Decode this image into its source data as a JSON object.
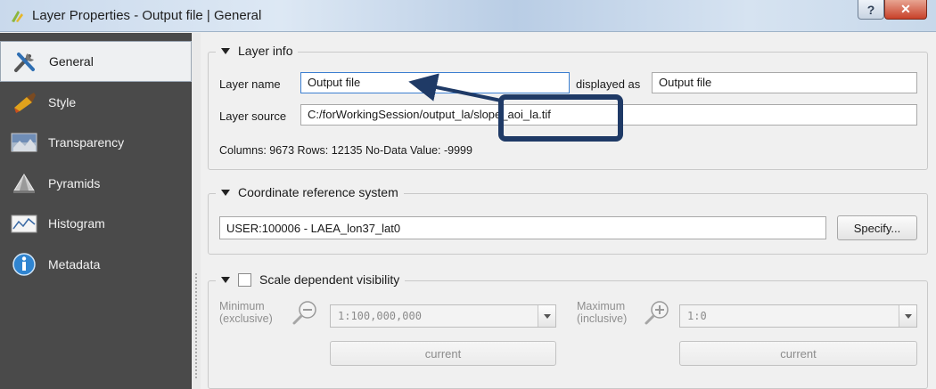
{
  "window": {
    "title": "Layer Properties - Output file | General",
    "help_label": "?",
    "close_label": "✕"
  },
  "sidebar": {
    "items": [
      {
        "label": "General",
        "icon": "tools-icon",
        "selected": true
      },
      {
        "label": "Style",
        "icon": "paintbrush-icon"
      },
      {
        "label": "Transparency",
        "icon": "transparency-icon"
      },
      {
        "label": "Pyramids",
        "icon": "pyramids-icon"
      },
      {
        "label": "Histogram",
        "icon": "histogram-icon"
      },
      {
        "label": "Metadata",
        "icon": "info-icon"
      }
    ]
  },
  "layer_info": {
    "header": "Layer info",
    "layer_name_label": "Layer name",
    "layer_name_value": "Output file",
    "displayed_as_label": "displayed as",
    "displayed_as_value": "Output file",
    "layer_source_label": "Layer source",
    "layer_source_value": "C:/forWorkingSession/output_la/slope_aoi_la.tif",
    "stats_text": "Columns: 9673  Rows: 12135  No-Data Value: -9999"
  },
  "crs": {
    "header": "Coordinate reference system",
    "value": "USER:100006 - LAEA_lon37_lat0",
    "specify_label": "Specify..."
  },
  "scale": {
    "header": "Scale dependent visibility",
    "checked": false,
    "minimum_label_1": "Minimum",
    "minimum_label_2": "(exclusive)",
    "minimum_value": "1:100,000,000",
    "maximum_label_1": "Maximum",
    "maximum_label_2": "(inclusive)",
    "maximum_value": "1:0",
    "current_label": "current"
  },
  "colors": {
    "annotation": "#1f3a66",
    "sidebar_bg": "#4a4a4a"
  }
}
